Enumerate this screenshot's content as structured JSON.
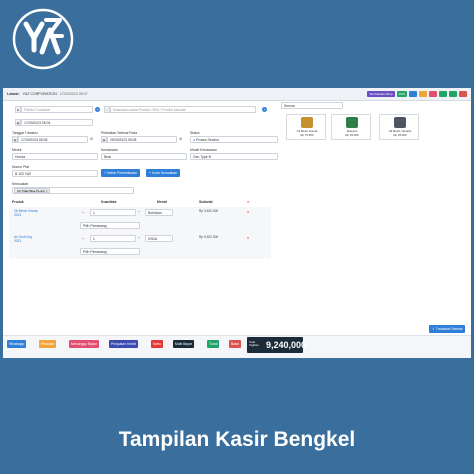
{
  "brand": {
    "logo_icon": "yaz-monogram-logo"
  },
  "topbar": {
    "lokasi_label": "Lokasi:",
    "lokasi_value": "YAZ CORPORATION",
    "datetime": "17/03/2023 05:07",
    "tambah_label": "Tambahkan Shop",
    "pos_label": "POS",
    "icons": [
      "user-icon",
      "flag-icon",
      "comment-icon",
      "calculator-icon",
      "expand-icon",
      "power-icon"
    ]
  },
  "form": {
    "customer_placeholder": "Pilih/Isi Customer",
    "product_search_placeholder": "Masukkan nama Produk / SKU / Produk barcode",
    "date_top": "17/03/2023 05:04",
    "tanggal_transaksi_label": "Tanggal Transksi",
    "tanggal_transaksi": "17/03/2023 05:08",
    "perbaikan_label": "Perbaikan Selesai Pada",
    "perbaikan": "25/03/2023 05:08",
    "status_label": "Status",
    "status": "Proses Service",
    "merek_label": "Merek",
    "merek": "Honda",
    "kendaraan_label": "Kendaraan",
    "kendaraan": "Beat",
    "model_label": "Model Kendaraan",
    "model": "Gen Type B",
    "nomor_label": "Nomor Plat",
    "nomor": "B 102 YAZ",
    "btn_daftar": "Daftar Pemeriksaan",
    "btn_kode": "Kode Kerusakan",
    "kerusakan_label": "Kerusakan",
    "kerusakan_chip": "Oli Tidak Bisa Penuh"
  },
  "table": {
    "headers": [
      "Produk",
      "Kuantitas",
      "Mentri",
      "Subtotal"
    ],
    "rows": [
      {
        "name": "Oli Mesin Honda",
        "sku": "3023",
        "qty": "1",
        "unit": "Botol/pcs",
        "subtotal": "Rp 3.520.000",
        "mech": "Pilih Pemasang"
      },
      {
        "name": "Air Gmbl-Ing",
        "sku": "3023",
        "qty": "1",
        "unit": "KSDA",
        "subtotal": "Rp 5.320.000",
        "mech": "Pilih Pemasang"
      }
    ]
  },
  "right": {
    "filter": "Semua",
    "products": [
      {
        "name": "Oli Mesin Honda",
        "price": "Rp 75.000",
        "color": "#c7902e"
      },
      {
        "name": "Aksesori",
        "price": "Rp 25.000",
        "color": "#2e7d4a"
      },
      {
        "name": "Oli Mesin Yamaha",
        "price": "Rp 45.000",
        "color": "#4d5560"
      }
    ],
    "btn_transaksi": "Transaksi Selesai"
  },
  "bottom": {
    "buttons": [
      {
        "label": "Whatsapp",
        "color": "#2f7ed8"
      },
      {
        "label": "Pesanan",
        "color": "#f0a53a"
      },
      {
        "label": "Menunggu Bayar",
        "color": "#e24e6f"
      },
      {
        "label": "Penjualan Kredit",
        "color": "#3c4bb0"
      },
      {
        "label": "Kartu",
        "color": "#e53935"
      },
      {
        "label": "Multi Bayar",
        "color": "#1c2b3a"
      },
      {
        "label": "Tunai",
        "color": "#22a36a"
      },
      {
        "label": "Batal",
        "color": "#d9534f"
      }
    ],
    "total_label": "Total Tagihan",
    "total_value": "9,240,000"
  },
  "caption": "Tampilan Kasir Bengkel"
}
